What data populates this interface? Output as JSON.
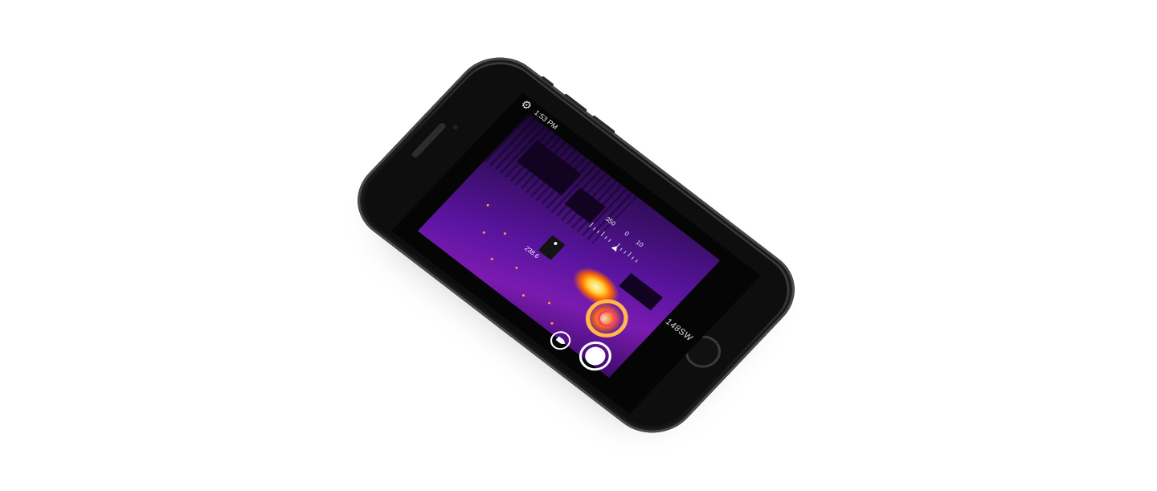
{
  "status_bar": {
    "time": "1:53 PM",
    "settings_icon": "gear-icon"
  },
  "temperature_scale": {
    "labels": [
      "350",
      "0",
      "10"
    ]
  },
  "spot_meter": {
    "value": "238.6",
    "icon": "spot-dot-icon"
  },
  "palette": {
    "label": "148SW"
  },
  "controls": {
    "shutter_icon": "shutter-circle-icon",
    "mode_icon": "video-camera-icon"
  },
  "colors": {
    "thermal_dark": "#1a0632",
    "thermal_mid": "#5a14a0",
    "thermal_hot": "#ffd23d",
    "phone_body": "#1b1b1d"
  }
}
